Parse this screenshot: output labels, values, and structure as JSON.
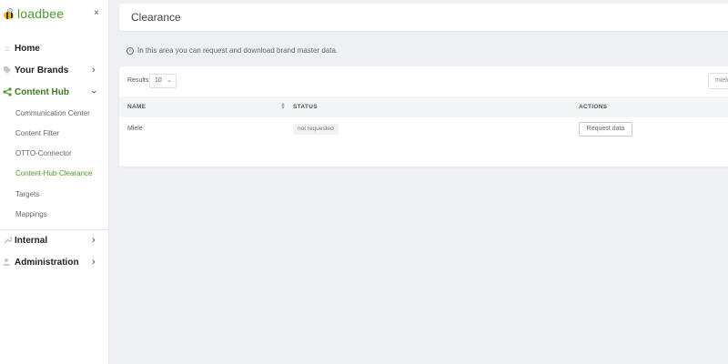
{
  "sidebar": {
    "logo_text": "loadbee",
    "close_label": "×",
    "items": [
      {
        "label": "Home",
        "icon": "home-icon"
      },
      {
        "label": "Your Brands",
        "icon": "tag-icon"
      },
      {
        "label": "Content Hub",
        "icon": "share-icon"
      },
      {
        "label": "Internal",
        "icon": "wrench-icon"
      },
      {
        "label": "Administration",
        "icon": "users-icon"
      }
    ],
    "sub_items": [
      {
        "label": "Communication Center"
      },
      {
        "label": "Content Filter"
      },
      {
        "label": "OTTO-Connector"
      },
      {
        "label": "Content-Hub-Clearance"
      },
      {
        "label": "Targets"
      },
      {
        "label": "Mappings"
      }
    ],
    "active_item": "Content Hub",
    "active_sub_item": "Content-Hub-Clearance"
  },
  "page": {
    "title": "Clearance",
    "info_text": "In this area you can request and download brand master data."
  },
  "table": {
    "results_label": "Results",
    "results_value": "10",
    "search_value": "miele",
    "columns": [
      "NAME",
      "STATUS",
      "ACTIONS"
    ],
    "rows": [
      {
        "name": "Miele",
        "status": "not requested",
        "action": "Request data"
      }
    ]
  },
  "colors": {
    "accent": "#4e9a2c",
    "background": "#eef0f3"
  }
}
